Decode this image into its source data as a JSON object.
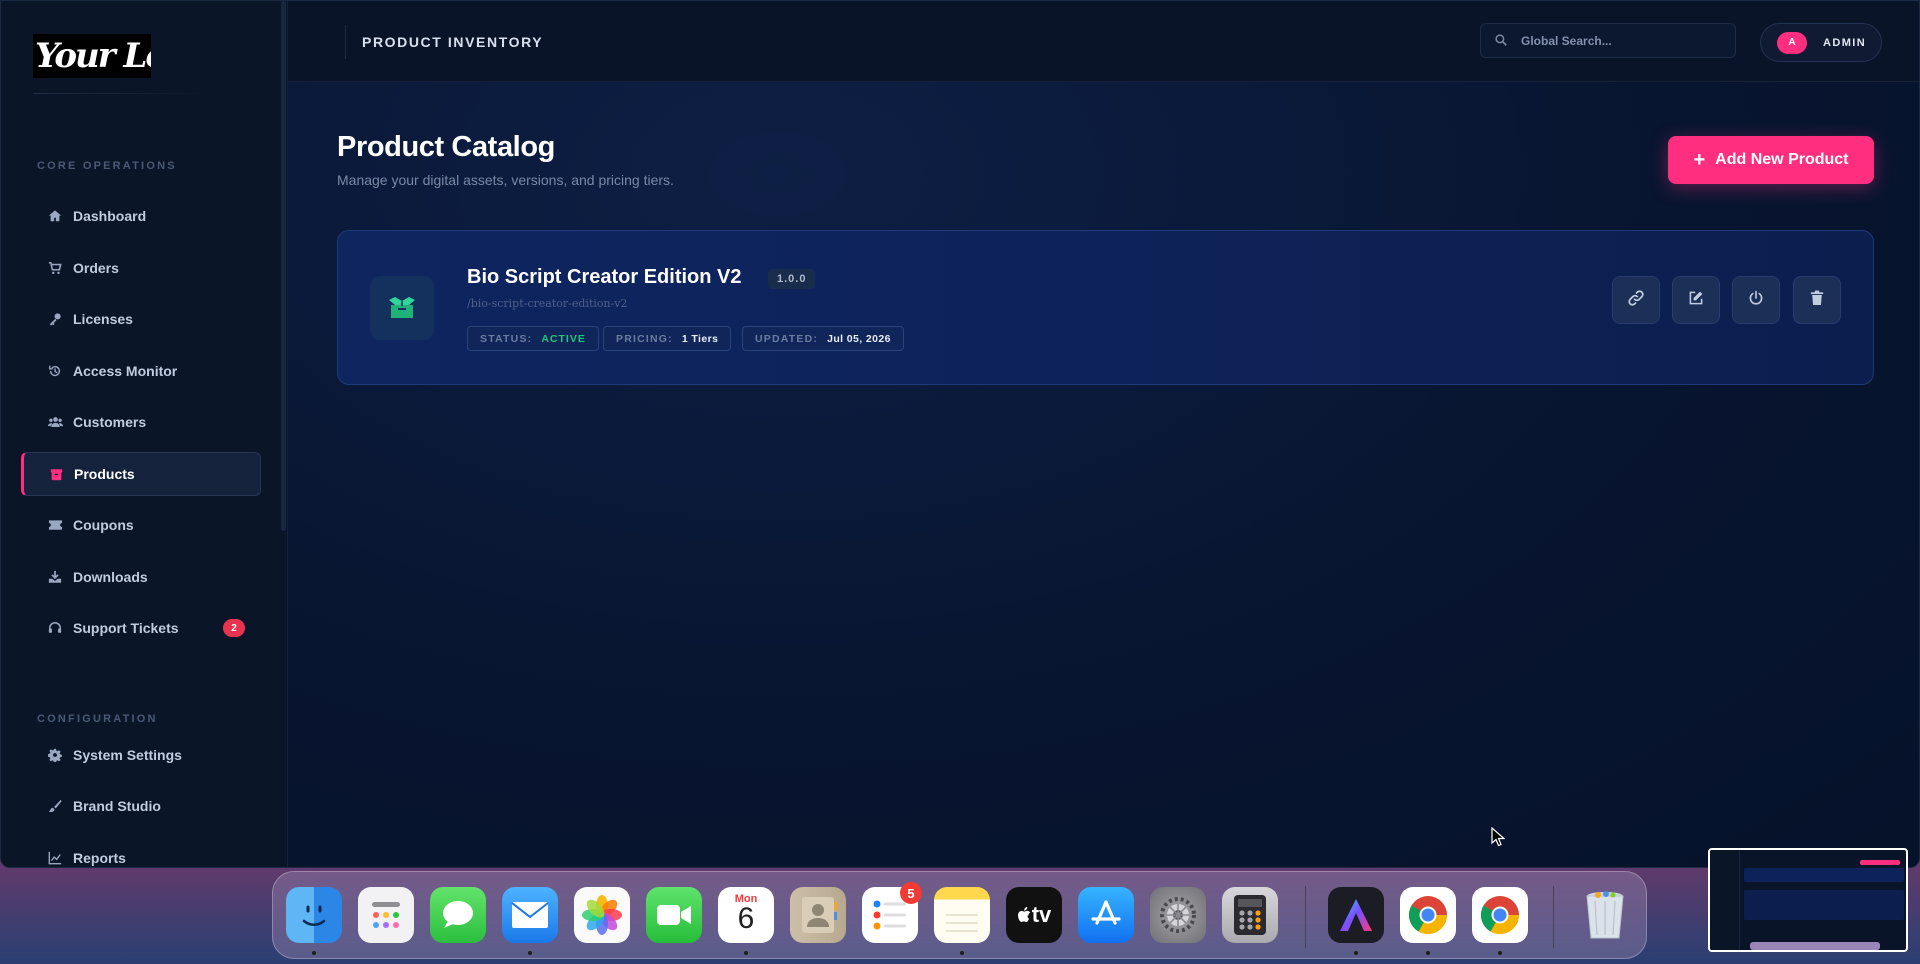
{
  "logo_text": "Your Logo",
  "sidebar": {
    "sections": [
      {
        "label": "CORE OPERATIONS"
      },
      {
        "label": "CONFIGURATION"
      }
    ],
    "items": [
      {
        "label": "Dashboard",
        "icon": "home-icon"
      },
      {
        "label": "Orders",
        "icon": "cart-icon"
      },
      {
        "label": "Licenses",
        "icon": "key-icon"
      },
      {
        "label": "Access Monitor",
        "icon": "history-icon"
      },
      {
        "label": "Customers",
        "icon": "users-icon"
      },
      {
        "label": "Products",
        "icon": "box-icon",
        "active": true
      },
      {
        "label": "Coupons",
        "icon": "ticket-icon"
      },
      {
        "label": "Downloads",
        "icon": "download-icon"
      },
      {
        "label": "Support Tickets",
        "icon": "headset-icon",
        "badge": "2"
      },
      {
        "label": "System Settings",
        "icon": "gear-icon"
      },
      {
        "label": "Brand Studio",
        "icon": "brush-icon"
      },
      {
        "label": "Reports",
        "icon": "chart-line-icon"
      }
    ]
  },
  "topbar": {
    "heading": "PRODUCT INVENTORY",
    "search_placeholder": "Global Search...",
    "user_initial": "A",
    "user_name": "ADMIN"
  },
  "main": {
    "title": "Product Catalog",
    "subtitle": "Manage your digital assets, versions, and pricing tiers.",
    "add_button": "Add New Product"
  },
  "products": [
    {
      "name": "Bio Script Creator Edition V2",
      "version": "1.0.0",
      "slug": "/bio-script-creator-edition-v2",
      "status_label": "STATUS:",
      "status_value": "ACTIVE",
      "pricing_label": "PRICING:",
      "pricing_value": "1 Tiers",
      "updated_label": "UPDATED:",
      "updated_value": "Jul 05, 2026"
    }
  ],
  "dock": {
    "calendar_month": "Mon",
    "calendar_day": "6",
    "reminders_badge": "5",
    "tv_label": "tv",
    "apps": [
      "finder-icon",
      "launchpad-icon",
      "messages-icon",
      "mail-icon",
      "photos-icon",
      "facetime-icon",
      "calendar-icon",
      "contacts-icon",
      "reminders-icon",
      "notes-icon",
      "apple-tv-icon",
      "app-store-icon",
      "system-settings-icon",
      "calculator-icon",
      "affinity-icon",
      "chrome-icon",
      "chrome-icon",
      "trash-icon"
    ]
  },
  "colors": {
    "accent": "#ff2e7e",
    "status_active": "#22c47a",
    "badge_red": "#e8334f"
  }
}
